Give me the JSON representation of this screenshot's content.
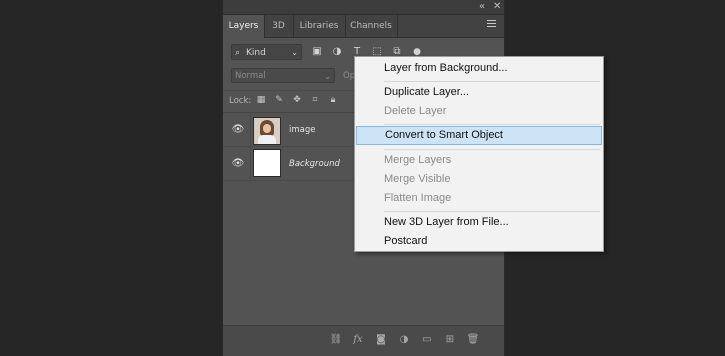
{
  "panel": {
    "window_controls": {
      "collapse": "«",
      "close": "✕"
    },
    "tabs": [
      {
        "label": "Layers",
        "active": true
      },
      {
        "label": "3D",
        "active": false
      },
      {
        "label": "Libraries",
        "active": false
      },
      {
        "label": "Channels",
        "active": false
      }
    ],
    "filter": {
      "kind_label": "Kind"
    },
    "blend_mode": "Normal",
    "opacity_label": "Op",
    "lock_label": "Lock:",
    "layers": [
      {
        "name": "image",
        "italic": false,
        "visible": true
      },
      {
        "name": "Background",
        "italic": true,
        "visible": true
      }
    ]
  },
  "context_menu": {
    "items": [
      {
        "label": "Layer from Background...",
        "disabled": false
      },
      {
        "label": "Duplicate Layer...",
        "disabled": false
      },
      {
        "label": "Delete Layer",
        "disabled": true
      },
      {
        "label": "Convert to Smart Object",
        "disabled": false,
        "highlighted": true
      },
      {
        "label": "Merge Layers",
        "disabled": true
      },
      {
        "label": "Merge Visible",
        "disabled": true
      },
      {
        "label": "Flatten Image",
        "disabled": true
      },
      {
        "label": "New 3D Layer from File...",
        "disabled": false
      },
      {
        "label": "Postcard",
        "disabled": false
      }
    ]
  },
  "colors": {
    "background": "#262626",
    "panel": "#535353",
    "menu_bg": "#f2f2f2",
    "menu_highlight": "#cde4f6"
  }
}
